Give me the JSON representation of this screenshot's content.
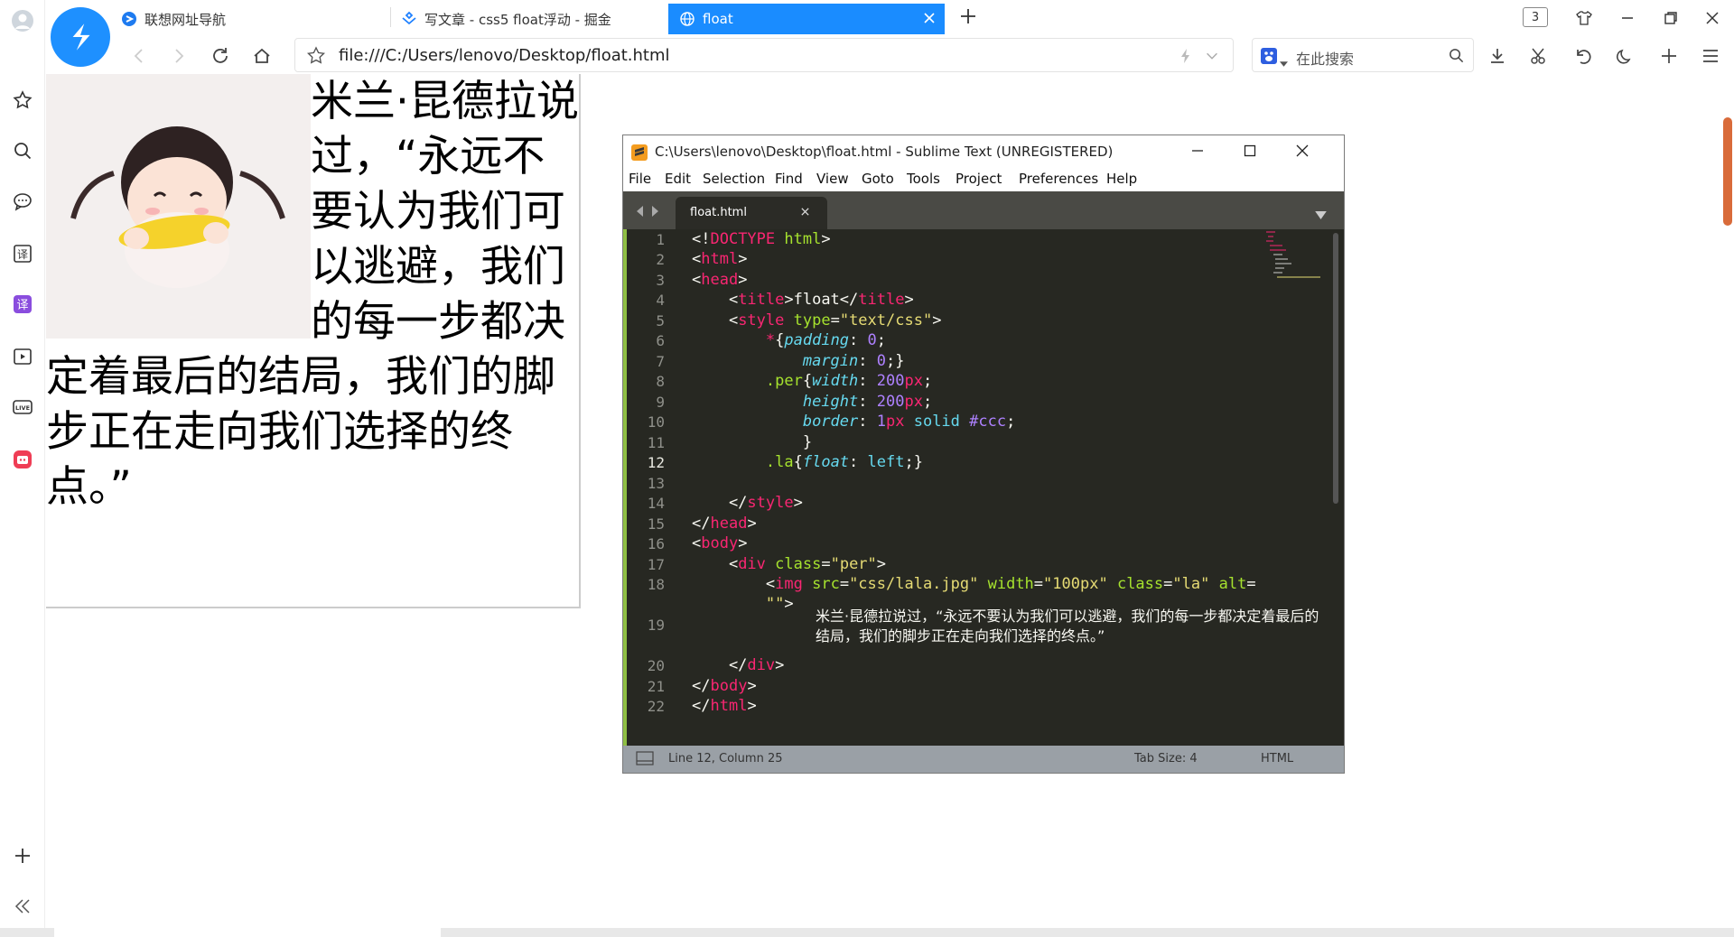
{
  "tabs": [
    {
      "label": "联想网址导航"
    },
    {
      "label": "写文章 - css5 float浮动 - 掘金"
    },
    {
      "label": "float"
    }
  ],
  "tab_count": "3",
  "address": {
    "url": "file:///C:/Users/lenovo/Desktop/float.html"
  },
  "search": {
    "placeholder": "在此搜索"
  },
  "page": {
    "text": "米兰·昆德拉说过，“永远不要认为我们可以逃避，我们的每一步都决定着最后的结局，我们的脚步正在走向我们选择的终点。”"
  },
  "sublime": {
    "title": "C:\\Users\\lenovo\\Desktop\\float.html - Sublime Text (UNREGISTERED)",
    "menu": [
      "File",
      "Edit",
      "Selection",
      "Find",
      "View",
      "Goto",
      "Tools",
      "Project",
      "Preferences",
      "Help"
    ],
    "tab_label": "float.html",
    "status_left": "Line 12, Column 25",
    "status_tab": "Tab Size: 4",
    "status_syntax": "HTML",
    "line_numbers": [
      "1",
      "2",
      "3",
      "4",
      "5",
      "6",
      "7",
      "8",
      "9",
      "10",
      "11",
      "12",
      "13",
      "14",
      "15",
      "16",
      "17",
      "18",
      "",
      "19",
      "",
      "20",
      "21",
      "22"
    ]
  },
  "colors": {
    "accent": "#1a8cff",
    "editor_bg": "#272822",
    "gutter_mark": "#8fbf44"
  }
}
